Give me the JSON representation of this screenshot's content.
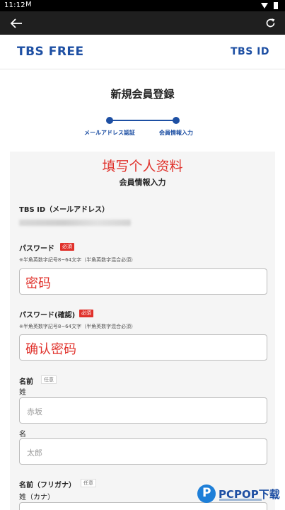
{
  "status_bar": {
    "time": "11:12",
    "mail_icon": "M"
  },
  "app_bar": {
    "back_icon": "back-arrow-icon",
    "reload_icon": "reload-icon"
  },
  "header": {
    "logo_left": "TBS FREE",
    "logo_right": "TBS ID"
  },
  "page": {
    "title": "新規会員登録"
  },
  "stepper": {
    "step1": "メールアドレス認証",
    "step2": "会員情報入力"
  },
  "overlay": {
    "title": "填写个人资料"
  },
  "form": {
    "section_title": "会員情報入力",
    "email_label": "TBS ID（メールアドレス）",
    "password": {
      "label": "パスワード",
      "badge": "必須",
      "hint": "※半角英数字記号8~64文字（半角英数字混合必須）",
      "value": "密码"
    },
    "password_confirm": {
      "label": "パスワード(確認)",
      "badge": "必須",
      "hint": "※半角英数字記号8~64文字（半角英数字混合必須）",
      "value": "确认密码"
    },
    "name": {
      "label": "名前",
      "badge": "任意",
      "sei_label": "姓",
      "sei_placeholder": "赤坂",
      "mei_label": "名",
      "mei_placeholder": "太郎"
    },
    "kana": {
      "label": "名前（フリガナ）",
      "badge": "任意",
      "sei_label": "姓（カナ）"
    }
  },
  "watermark": {
    "logo_letter": "P",
    "text": "PCPOP下载"
  },
  "colors": {
    "brand": "#1d4fa3",
    "required": "#e0312b",
    "appbar": "#1f1f1f"
  }
}
